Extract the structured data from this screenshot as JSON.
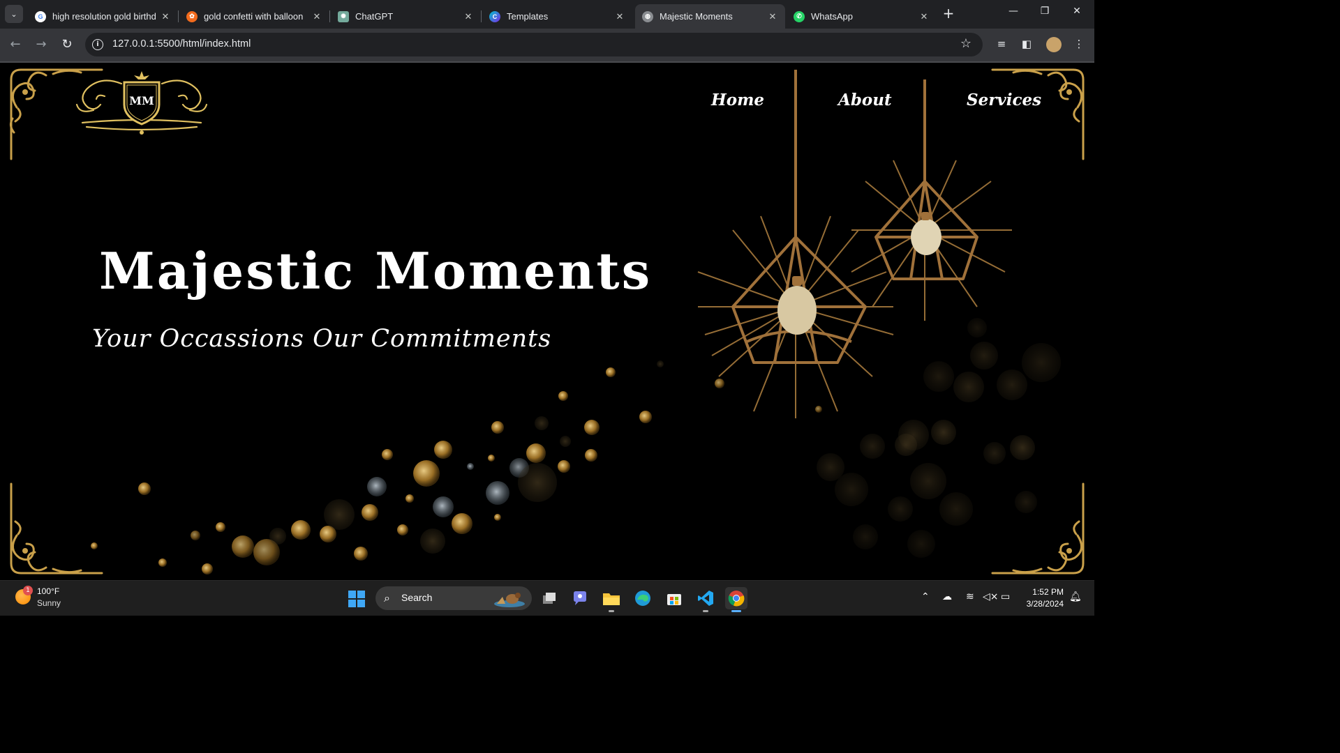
{
  "browser": {
    "tabs": [
      {
        "title": "high resolution gold birthd",
        "icon": "google-icon",
        "active": false
      },
      {
        "title": "gold confetti with balloon",
        "icon": "brave-icon",
        "active": false
      },
      {
        "title": "ChatGPT",
        "icon": "chatgpt-icon",
        "active": false
      },
      {
        "title": "Templates",
        "icon": "canva-icon",
        "active": false
      },
      {
        "title": "Majestic Moments",
        "icon": "globe-icon",
        "active": true
      },
      {
        "title": "WhatsApp",
        "icon": "whatsapp-icon",
        "active": false
      }
    ],
    "new_tab": "+",
    "address": "127.0.0.1:5500/html/index.html"
  },
  "site": {
    "logo_monogram": "MM",
    "nav": [
      "Home",
      "About",
      "Services"
    ],
    "title": "Majestic Moments",
    "subtitle": "Your Occassions Our Commitments",
    "colors": {
      "gold": "#c9a04a",
      "background": "#000000",
      "text": "#ffffff"
    }
  },
  "taskbar": {
    "weather_badge": "1",
    "temperature": "100°F",
    "condition": "Sunny",
    "search_label": "Search",
    "time": "1:52 PM",
    "date": "3/28/2024"
  }
}
